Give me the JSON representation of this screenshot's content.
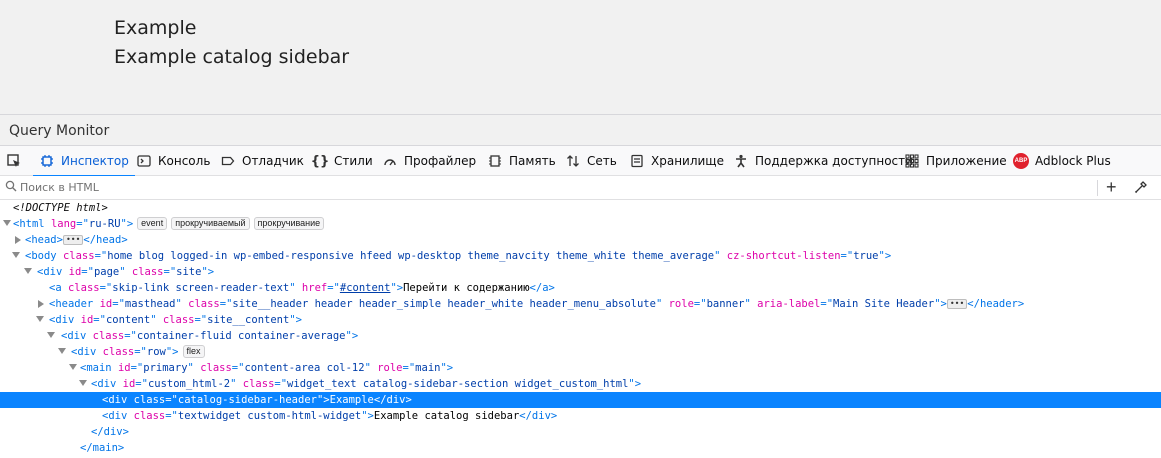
{
  "page": {
    "line1": "Example",
    "line2": "Example catalog sidebar"
  },
  "query_monitor": {
    "title": "Query Monitor"
  },
  "toolbar": {
    "tabs": [
      {
        "label": "Инспектор",
        "icon": "inspector-icon",
        "active": true
      },
      {
        "label": "Консоль",
        "icon": "console-icon"
      },
      {
        "label": "Отладчик",
        "icon": "debugger-icon"
      },
      {
        "label": "Стили",
        "icon": "braces-icon"
      },
      {
        "label": "Профайлер",
        "icon": "profiler-icon"
      },
      {
        "label": "Память",
        "icon": "memory-icon"
      },
      {
        "label": "Сеть",
        "icon": "network-icon"
      },
      {
        "label": "Хранилище",
        "icon": "storage-icon"
      },
      {
        "label": "Поддержка доступности",
        "icon": "accessibility-icon"
      },
      {
        "label": "Приложение",
        "icon": "grid-icon"
      },
      {
        "label": "Adblock Plus",
        "icon": "abp-icon",
        "abp_text": "ABP"
      }
    ],
    "accent_color": "#0a84ff"
  },
  "search": {
    "placeholder": "Поиск в HTML"
  },
  "tree": {
    "doctype": "<!DOCTYPE html>",
    "html": {
      "tag": "html",
      "attr": "lang",
      "value": "ru-RU",
      "badges": [
        "event",
        "прокручиваемый",
        "прокручивание"
      ]
    },
    "head": {
      "open": "<head>",
      "close": "</head>"
    },
    "body": {
      "tag": "body",
      "attrs": [
        {
          "name": "class",
          "value": "home blog logged-in wp-embed-responsive hfeed wp-desktop theme_navcity theme_white theme_average"
        },
        {
          "name": "cz-shortcut-listen",
          "value": "true"
        }
      ]
    },
    "page_div": {
      "tag": "div",
      "id": "page",
      "class": "site"
    },
    "skip_link": {
      "tag": "a",
      "class": "skip-link screen-reader-text",
      "href": "#content",
      "text": "Перейти к содержанию"
    },
    "header": {
      "tag": "header",
      "id": "masthead",
      "class": "site__header header header_simple header_white header_menu_absolute",
      "role": "banner",
      "aria_label": "Main Site Header"
    },
    "content_div": {
      "tag": "div",
      "id": "content",
      "class": "site__content"
    },
    "container": {
      "tag": "div",
      "class": "container-fluid container-average"
    },
    "row": {
      "tag": "div",
      "class": "row",
      "badge": "flex"
    },
    "main": {
      "tag": "main",
      "id": "primary",
      "class": "content-area col-12",
      "role": "main"
    },
    "widget": {
      "tag": "div",
      "id": "custom_html-2",
      "class": "widget_text catalog-sidebar-section widget_custom_html"
    },
    "header_div": {
      "tag": "div",
      "class": "catalog-sidebar-header",
      "text": "Example"
    },
    "textwidget": {
      "tag": "div",
      "class": "textwidget custom-html-widget",
      "text": "Example catalog sidebar"
    },
    "close_div": "</div>",
    "close_main": "</main>"
  }
}
